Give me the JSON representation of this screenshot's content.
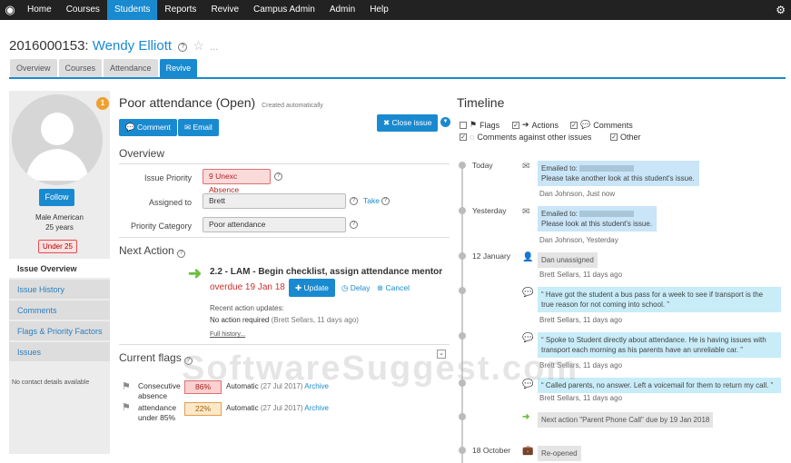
{
  "nav": {
    "items": [
      "Home",
      "Courses",
      "Students",
      "Reports",
      "Revive",
      "Campus Admin",
      "Admin",
      "Help"
    ]
  },
  "title": {
    "id": "2016000153:",
    "name": "Wendy Elliott",
    "ellipsis": "..."
  },
  "tabs": [
    "Overview",
    "Courses",
    "Attendance",
    "Revive"
  ],
  "sidebar": {
    "badge": "1",
    "follow": "Follow",
    "demo_line1": "Male American",
    "demo_line2": "25 years",
    "under": "Under 25",
    "nav": [
      "Issue Overview",
      "Issue History",
      "Comments",
      "Flags & Priority Factors",
      "Issues"
    ],
    "no_contact": "No contact details available"
  },
  "issue": {
    "title": "Poor attendance (Open)",
    "created": "Created automatically",
    "comment_btn": "Comment",
    "email_btn": "Email",
    "close_btn": "Close issue"
  },
  "overview": {
    "heading": "Overview",
    "priority_label": "Issue Priority",
    "priority_value": "9 Unexc Absence",
    "assigned_label": "Assigned to",
    "assigned_value": "Brett",
    "take": "Take",
    "category_label": "Priority Category",
    "category_value": "Poor attendance"
  },
  "next_action": {
    "heading": "Next Action",
    "title": "2.2 - LAM - Begin checklist, assign attendance mentor",
    "overdue": "overdue 19 Jan 18",
    "update": "Update",
    "delay": "Delay",
    "cancel": "Cancel",
    "recent_label": "Recent action updates:",
    "recent_text": "No action required",
    "recent_meta": "(Brett Sellars, 11 days ago)",
    "full_history": "Full history..."
  },
  "flags": {
    "heading": "Current flags",
    "items": [
      {
        "name": "Consecutive absence",
        "pct": "86%",
        "meta": "Automatic",
        "date": "(27 Jul 2017)",
        "archive": "Archive"
      },
      {
        "name": "attendance under 85%",
        "pct": "22%",
        "meta": "Automatic",
        "date": "(27 Jul 2017)",
        "archive": "Archive"
      }
    ]
  },
  "timeline": {
    "title": "Timeline",
    "filters": [
      "Flags",
      "Actions",
      "Comments",
      "Comments against other issues",
      "Other"
    ],
    "entries": [
      {
        "date": "Today",
        "line1": "Emailed to:",
        "line2": "Please take another look at this student's issue.",
        "meta": "Dan Johnson, Just now"
      },
      {
        "date": "Yesterday",
        "line1": "Emailed to:",
        "line2": "Please look at this student's issue.",
        "meta": "Dan Johnson, Yesterday"
      },
      {
        "date": "12 January",
        "line1": "Dan unassigned",
        "meta": "Brett Sellars, 11 days ago"
      },
      {
        "line1": "“ Have got the student a bus pass for a week to see if transport is the",
        "line2": "true reason for not coming into school. ”",
        "meta": "Brett Sellars, 11 days ago"
      },
      {
        "line1": "“ Spoke to Student directly about attendance. He is having issues with",
        "line2": "transport each morning as his parents have an unreliable car. ”",
        "meta": "Brett Sellars, 11 days ago"
      },
      {
        "line1": "“ Called parents, no answer. Left a voicemail for them to return my call. ”",
        "meta": "Brett Sellars, 11 days ago"
      },
      {
        "line1": "Next action \"Parent Phone Call\" due by 19 Jan 2018"
      },
      {
        "date": "18 October",
        "line1": "Re-opened"
      }
    ]
  },
  "watermark": "SoftwareSuggest.com"
}
